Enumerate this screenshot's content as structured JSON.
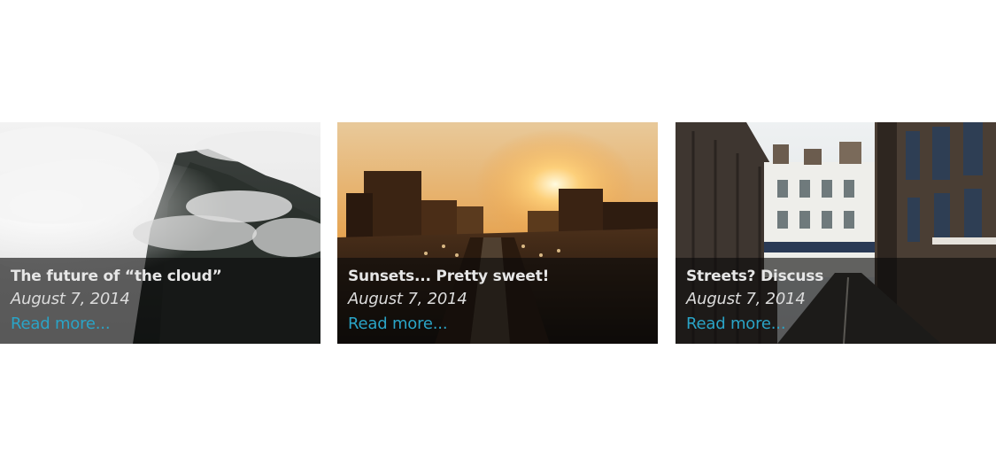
{
  "posts": [
    {
      "title": "The future of “the cloud”",
      "date": "August 7, 2014",
      "read_more": "Read more...",
      "image": "misty-mountain-photo"
    },
    {
      "title": "Sunsets... Pretty sweet!",
      "date": "August 7, 2014",
      "read_more": "Read more...",
      "image": "city-sunset-highway-photo"
    },
    {
      "title": "Streets? Discuss",
      "date": "August 7, 2014",
      "read_more": "Read more...",
      "image": "brick-street-photo"
    }
  ],
  "colors": {
    "link": "#2aa4c7",
    "overlay": "#0a0a0a",
    "title_text": "#e6e6e6"
  }
}
